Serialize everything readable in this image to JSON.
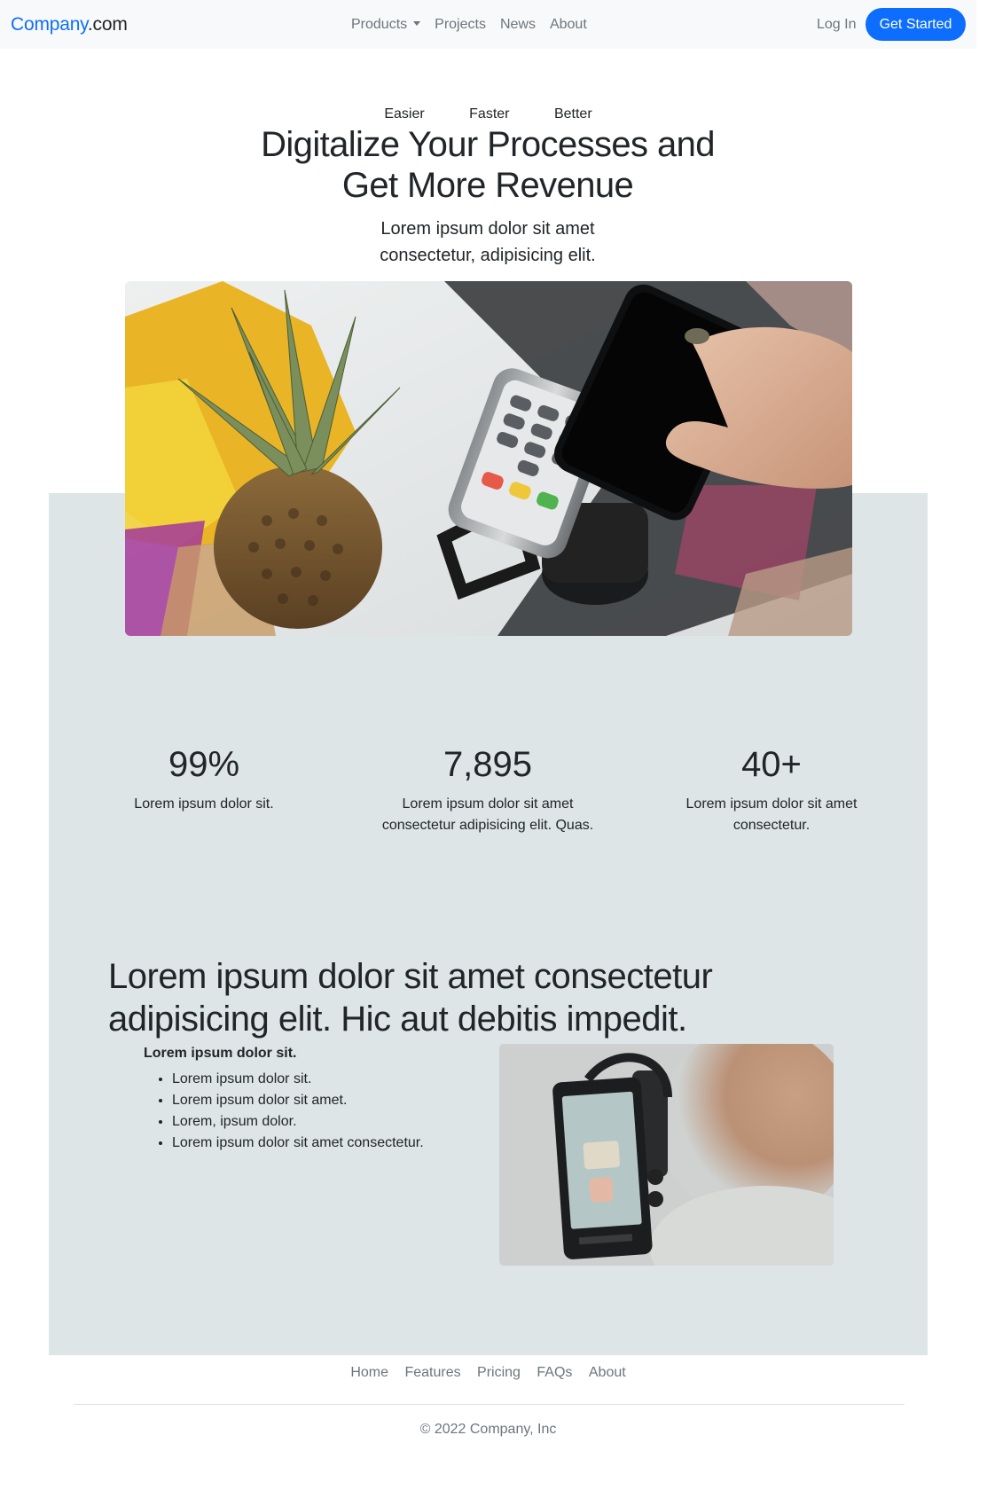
{
  "navbar": {
    "brand_main": "Company",
    "brand_suffix": ".com",
    "links": [
      {
        "label": "Products"
      },
      {
        "label": "Projects"
      },
      {
        "label": "News"
      },
      {
        "label": "About"
      }
    ],
    "login": "Log In",
    "cta": "Get Started"
  },
  "hero": {
    "taglines": [
      "Easier",
      "Faster",
      "Better"
    ],
    "title": "Digitalize Your Processes and Get More Revenue",
    "subtitle": "Lorem ipsum dolor sit amet consectetur, adipisicing elit."
  },
  "stats": [
    {
      "value": "99%",
      "text": "Lorem ipsum dolor sit."
    },
    {
      "value": "7,895",
      "text": "Lorem ipsum dolor sit amet consectetur adipisicing elit. Quas."
    },
    {
      "value": "40+",
      "text": "Lorem ipsum dolor sit amet consectetur."
    }
  ],
  "feature": {
    "title": "Lorem ipsum dolor sit amet consectetur adipisicing elit. Hic aut debitis impedit.",
    "list_title": "Lorem ipsum dolor sit.",
    "items": [
      "Lorem ipsum dolor sit.",
      "Lorem ipsum dolor sit amet.",
      "Lorem, ipsum dolor.",
      "Lorem ipsum dolor sit amet consectetur."
    ]
  },
  "footer": {
    "links": [
      "Home",
      "Features",
      "Pricing",
      "FAQs",
      "About"
    ],
    "copyright": "© 2022 Company, Inc"
  },
  "colors": {
    "primary": "#0d6efd",
    "section_background": "#dde5e6",
    "muted_text": "#6c757d",
    "navbar_background": "#f8f9fa"
  }
}
